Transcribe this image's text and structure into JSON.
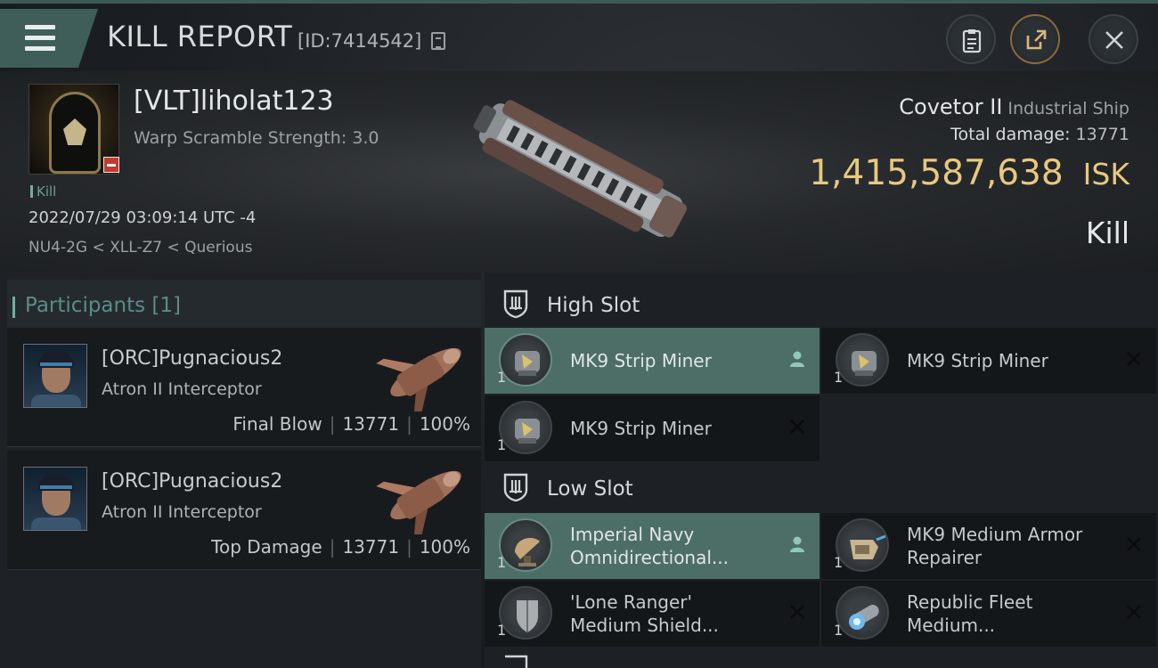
{
  "header": {
    "title": "KILL REPORT",
    "report_id": "[ID:7414542]"
  },
  "victim": {
    "name": "[VLT]liholat123",
    "warp_scramble": "Warp Scramble Strength: 3.0",
    "kill_tag": "Kill",
    "datetime": "2022/07/29 03:09:14 UTC -4",
    "location": "NU4-2G < XLL-Z7 < Querious",
    "ship_name": "Covetor II",
    "ship_class": "Industrial Ship",
    "total_damage_label": "Total damage:",
    "total_damage": "13771",
    "isk_value": "1,415,587,638",
    "isk_unit": "ISK",
    "result": "Kill"
  },
  "participants": {
    "header": "Participants [1]",
    "items": [
      {
        "name": "[ORC]Pugnacious2",
        "ship": "Atron II Interceptor",
        "role": "Final Blow",
        "damage": "13771",
        "percent": "100%"
      },
      {
        "name": "[ORC]Pugnacious2",
        "ship": "Atron II Interceptor",
        "role": "Top Damage",
        "damage": "13771",
        "percent": "100%"
      }
    ]
  },
  "slots": {
    "high": {
      "label": "High Slot",
      "modules": [
        {
          "line1": "MK9 Strip Miner",
          "line2": "",
          "qty": "1",
          "state": "person-icon"
        },
        {
          "line1": "MK9 Strip Miner",
          "line2": "",
          "qty": "1",
          "state": "x-icon"
        },
        {
          "line1": "MK9 Strip Miner",
          "line2": "",
          "qty": "1",
          "state": "x-icon"
        }
      ]
    },
    "low": {
      "label": "Low Slot",
      "modules": [
        {
          "line1": "Imperial Navy",
          "line2": "Omnidirectional...",
          "qty": "1",
          "state": "person-icon"
        },
        {
          "line1": "MK9 Medium Armor",
          "line2": "Repairer",
          "qty": "1",
          "state": "x-icon"
        },
        {
          "line1": "'Lone Ranger'",
          "line2": "Medium Shield...",
          "qty": "1",
          "state": "x-icon"
        },
        {
          "line1": "Republic Fleet",
          "line2": "Medium...",
          "qty": "1",
          "state": "x-icon"
        }
      ]
    }
  },
  "colors": {
    "accent": "#4d6e67",
    "isk": "#e8c87f",
    "badge_red": "#c23b31"
  }
}
